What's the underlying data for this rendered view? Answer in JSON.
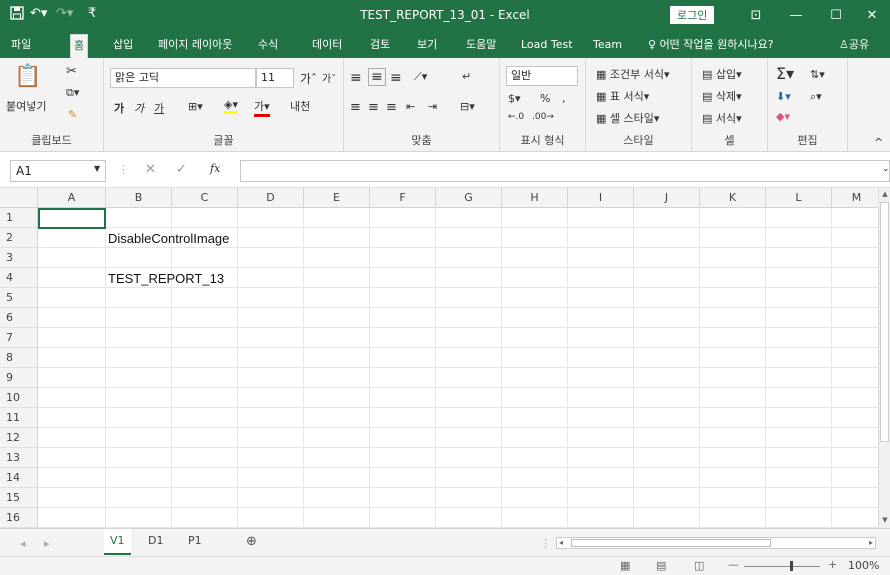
{
  "window": {
    "title": "TEST_REPORT_13_01  -  Excel",
    "login_label": "로그인",
    "controls": [
      "ribbon-display-icon",
      "minimize-icon",
      "maximize-icon",
      "close-icon"
    ]
  },
  "quick_access": {
    "save_icon": "save-icon",
    "undo_icon": "undo-icon",
    "redo_icon": "redo-icon",
    "customize_icon": "customize-icon"
  },
  "tabs": [
    {
      "label": "파일"
    },
    {
      "label": "홈"
    },
    {
      "label": "삽입"
    },
    {
      "label": "페이지 레이아웃"
    },
    {
      "label": "수식"
    },
    {
      "label": "데이터"
    },
    {
      "label": "검토"
    },
    {
      "label": "보기"
    },
    {
      "label": "도움말"
    },
    {
      "label": "Load Test"
    },
    {
      "label": "Team"
    }
  ],
  "tell_me": "어떤 작업을 원하시나요?",
  "share": "공유",
  "ribbon": {
    "clipboard": {
      "paste": "붙여넣기",
      "label": "클립보드"
    },
    "font": {
      "name": "맑은 고딕",
      "size": "11",
      "bold": "가",
      "italic": "가",
      "underline": "가",
      "label": "글꼴",
      "phonetic": "내천"
    },
    "alignment": {
      "label": "맞춤"
    },
    "number": {
      "format": "일반",
      "percent": "%",
      "comma": ",",
      "label": "표시 형식"
    },
    "styles": {
      "conditional": "조건부 서식",
      "table": "표 서식",
      "cell": "셀 스타일",
      "label": "스타일"
    },
    "cells": {
      "insert": "삽입",
      "delete": "삭제",
      "format": "서식",
      "label": "셀"
    },
    "editing": {
      "label": "편집"
    }
  },
  "formula_bar": {
    "name_box": "A1",
    "fx": "fx",
    "value": ""
  },
  "columns": [
    "A",
    "B",
    "C",
    "D",
    "E",
    "F",
    "G",
    "H",
    "I",
    "J",
    "K",
    "L",
    "M"
  ],
  "rows": [
    "1",
    "2",
    "3",
    "4",
    "5",
    "6",
    "7",
    "8",
    "9",
    "10",
    "11",
    "12",
    "13",
    "14",
    "15",
    "16"
  ],
  "cells": {
    "B2": "DisableControlImage",
    "B4": "TEST_REPORT_13"
  },
  "sheets": [
    "V1",
    "D1",
    "P1"
  ],
  "active_sheet": "V1",
  "status": {
    "zoom": "100%"
  },
  "colors": {
    "accent": "#217346"
  }
}
